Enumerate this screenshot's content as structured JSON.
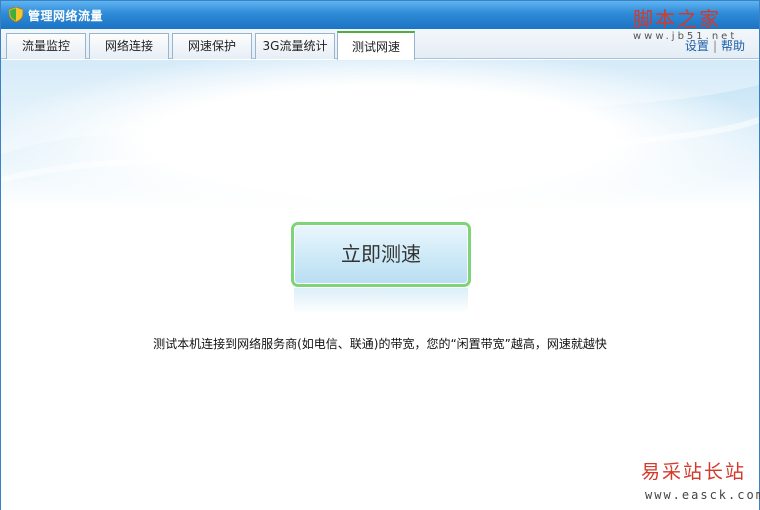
{
  "window": {
    "title": "管理网络流量",
    "icon": "shield-icon"
  },
  "tabs": [
    {
      "label": "流量监控",
      "active": false
    },
    {
      "label": "网络连接",
      "active": false
    },
    {
      "label": "网速保护",
      "active": false
    },
    {
      "label": "3G流量统计",
      "active": false
    },
    {
      "label": "测试网速",
      "active": true
    }
  ],
  "links": {
    "settings": "设置",
    "help": "帮助"
  },
  "main": {
    "speed_test_button": "立即测速",
    "description": "测试本机连接到网络服务商(如电信、联通)的带宽，您的“闲置带宽”越高，网速就越快"
  },
  "watermarks": {
    "top_brand": "脚本之家",
    "top_site": "www.jb51.net",
    "bottom_brand": "易采站长站",
    "bottom_site": "www.easck.com"
  },
  "colors": {
    "titlebar": "#2e8ad6",
    "button_border": "#7fd47a",
    "link": "#1d5fa8",
    "watermark": "#d33a2c"
  }
}
